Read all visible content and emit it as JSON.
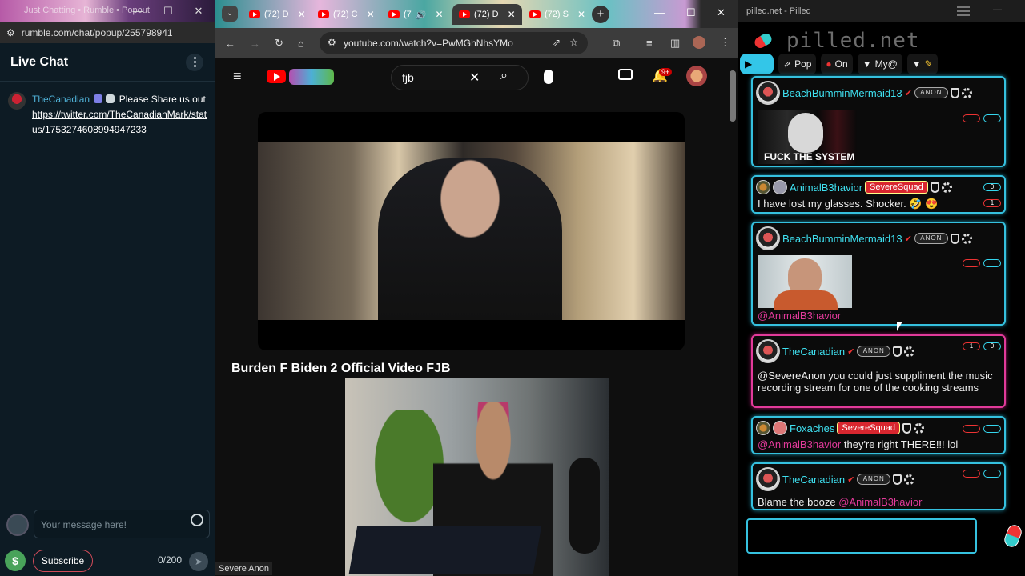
{
  "rumble": {
    "window_title": "Just Chatting • Rumble • Popout",
    "url": "rumble.com/chat/popup/255798941",
    "header_title": "Live Chat",
    "messages": [
      {
        "user": "TheCanadian",
        "text": "Please Share us out",
        "link": "https://twitter.com/TheCanadianMark/status/1753274608994947233",
        "link_line1": "https://twitter.com/TheCanadianMark/stat",
        "link_line2": "us/1753274608994947233"
      }
    ],
    "input_placeholder": "Your message here!",
    "dollar_label": "$",
    "subscribe_label": "Subscribe",
    "char_count": "0/200"
  },
  "youtube": {
    "tabs": [
      {
        "label": "(72) D"
      },
      {
        "label": "(72) C"
      },
      {
        "label": "(7"
      },
      {
        "label": "(72) D"
      },
      {
        "label": "(72) S"
      }
    ],
    "new_tab": "+",
    "url": "youtube.com/watch?v=PwMGhNhsYMo",
    "search_value": "fjb",
    "notifications_count": "9+",
    "video_title": "Burden F Biden 2 Official Video FJB",
    "webcam_label": "Severe Anon"
  },
  "pilled": {
    "window_title": "pilled.net - Pilled",
    "logo_text": "pilled.net",
    "toolbar": {
      "pop_label": "Pop",
      "on_label": "On",
      "my_label": "My@"
    },
    "messages": [
      {
        "user": "BeachBumminMermaid13",
        "image_caption": "FUCK THE SYSTEM"
      },
      {
        "user": "AnimalB3havior",
        "tag": "SevereSquad",
        "text": "I have lost my glasses. Shocker. 🤣 😍",
        "count_top": "0",
        "count_bottom": "1"
      },
      {
        "user": "BeachBumminMermaid13",
        "mention": "@AnimalB3havior"
      },
      {
        "user": "TheCanadian",
        "count_left": "1",
        "count_right": "0",
        "text": "@SevereAnon you could just suppliment the music recording stream for one of the cooking streams"
      },
      {
        "user": "Foxaches",
        "tag": "SevereSquad",
        "mention": "@AnimalB3havior",
        "text": "they're right THERE!!! lol"
      },
      {
        "user": "TheCanadian",
        "text": "Blame the booze",
        "mention": "@AnimalB3havior"
      }
    ],
    "anon_badge": "ANON",
    "colors": {
      "accent": "#35c1df",
      "highlight": "#e23a9a",
      "squad": "#d8262f"
    }
  }
}
